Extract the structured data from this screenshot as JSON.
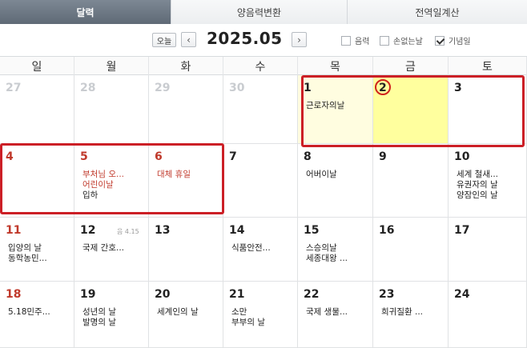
{
  "tabs": [
    {
      "label": "달력"
    },
    {
      "label": "양음력변환"
    },
    {
      "label": "전역일계산"
    }
  ],
  "toolbar": {
    "today_label": "오늘",
    "prev_icon": "‹",
    "next_icon": "›",
    "month_title": "2025.05",
    "caret_icon": "▾",
    "options": [
      {
        "label": "음력",
        "checked": false
      },
      {
        "label": "손없는날",
        "checked": false
      },
      {
        "label": "기념일",
        "checked": true
      }
    ]
  },
  "weekdays": [
    "일",
    "월",
    "화",
    "수",
    "목",
    "금",
    "토"
  ],
  "weeks": [
    [
      {
        "day": "27",
        "other": true,
        "events": []
      },
      {
        "day": "28",
        "other": true,
        "events": []
      },
      {
        "day": "29",
        "other": true,
        "events": []
      },
      {
        "day": "30",
        "other": true,
        "events": []
      },
      {
        "day": "1",
        "highlight": "cream",
        "events": [
          {
            "text": "근로자의날"
          }
        ]
      },
      {
        "day": "2",
        "highlight": "yellow",
        "circled": true,
        "events": []
      },
      {
        "day": "3",
        "events": []
      }
    ],
    [
      {
        "day": "4",
        "red": true,
        "events": []
      },
      {
        "day": "5",
        "red": true,
        "events": [
          {
            "text": "부처님 오...",
            "red": true
          },
          {
            "text": "어린이날",
            "red": true
          },
          {
            "text": "입하"
          }
        ]
      },
      {
        "day": "6",
        "red": true,
        "events": [
          {
            "text": "대체 휴일",
            "red": true
          }
        ]
      },
      {
        "day": "7",
        "events": []
      },
      {
        "day": "8",
        "events": [
          {
            "text": "어버이날"
          }
        ]
      },
      {
        "day": "9",
        "events": []
      },
      {
        "day": "10",
        "events": [
          {
            "text": "세계 철새..."
          },
          {
            "text": "유권자의 날"
          },
          {
            "text": "양잠인의 날"
          }
        ]
      }
    ],
    [
      {
        "day": "11",
        "red": true,
        "events": [
          {
            "text": "입양의 날"
          },
          {
            "text": "동학농민..."
          }
        ]
      },
      {
        "day": "12",
        "lunar": "음 4.15",
        "events": [
          {
            "text": "국제 간호..."
          }
        ]
      },
      {
        "day": "13",
        "events": []
      },
      {
        "day": "14",
        "events": [
          {
            "text": "식품안전..."
          }
        ]
      },
      {
        "day": "15",
        "events": [
          {
            "text": "스승의날"
          },
          {
            "text": "세종대왕 ..."
          }
        ]
      },
      {
        "day": "16",
        "events": []
      },
      {
        "day": "17",
        "events": []
      }
    ],
    [
      {
        "day": "18",
        "red": true,
        "events": [
          {
            "text": "5.18민주..."
          }
        ]
      },
      {
        "day": "19",
        "events": [
          {
            "text": "성년의 날"
          },
          {
            "text": "발명의 날"
          }
        ]
      },
      {
        "day": "20",
        "events": [
          {
            "text": "세계인의 날"
          }
        ]
      },
      {
        "day": "21",
        "events": [
          {
            "text": "소만"
          },
          {
            "text": "부부의 날"
          }
        ]
      },
      {
        "day": "22",
        "events": [
          {
            "text": "국제 생물..."
          }
        ]
      },
      {
        "day": "23",
        "events": [
          {
            "text": "희귀질환 ..."
          }
        ]
      },
      {
        "day": "24",
        "events": []
      }
    ]
  ]
}
